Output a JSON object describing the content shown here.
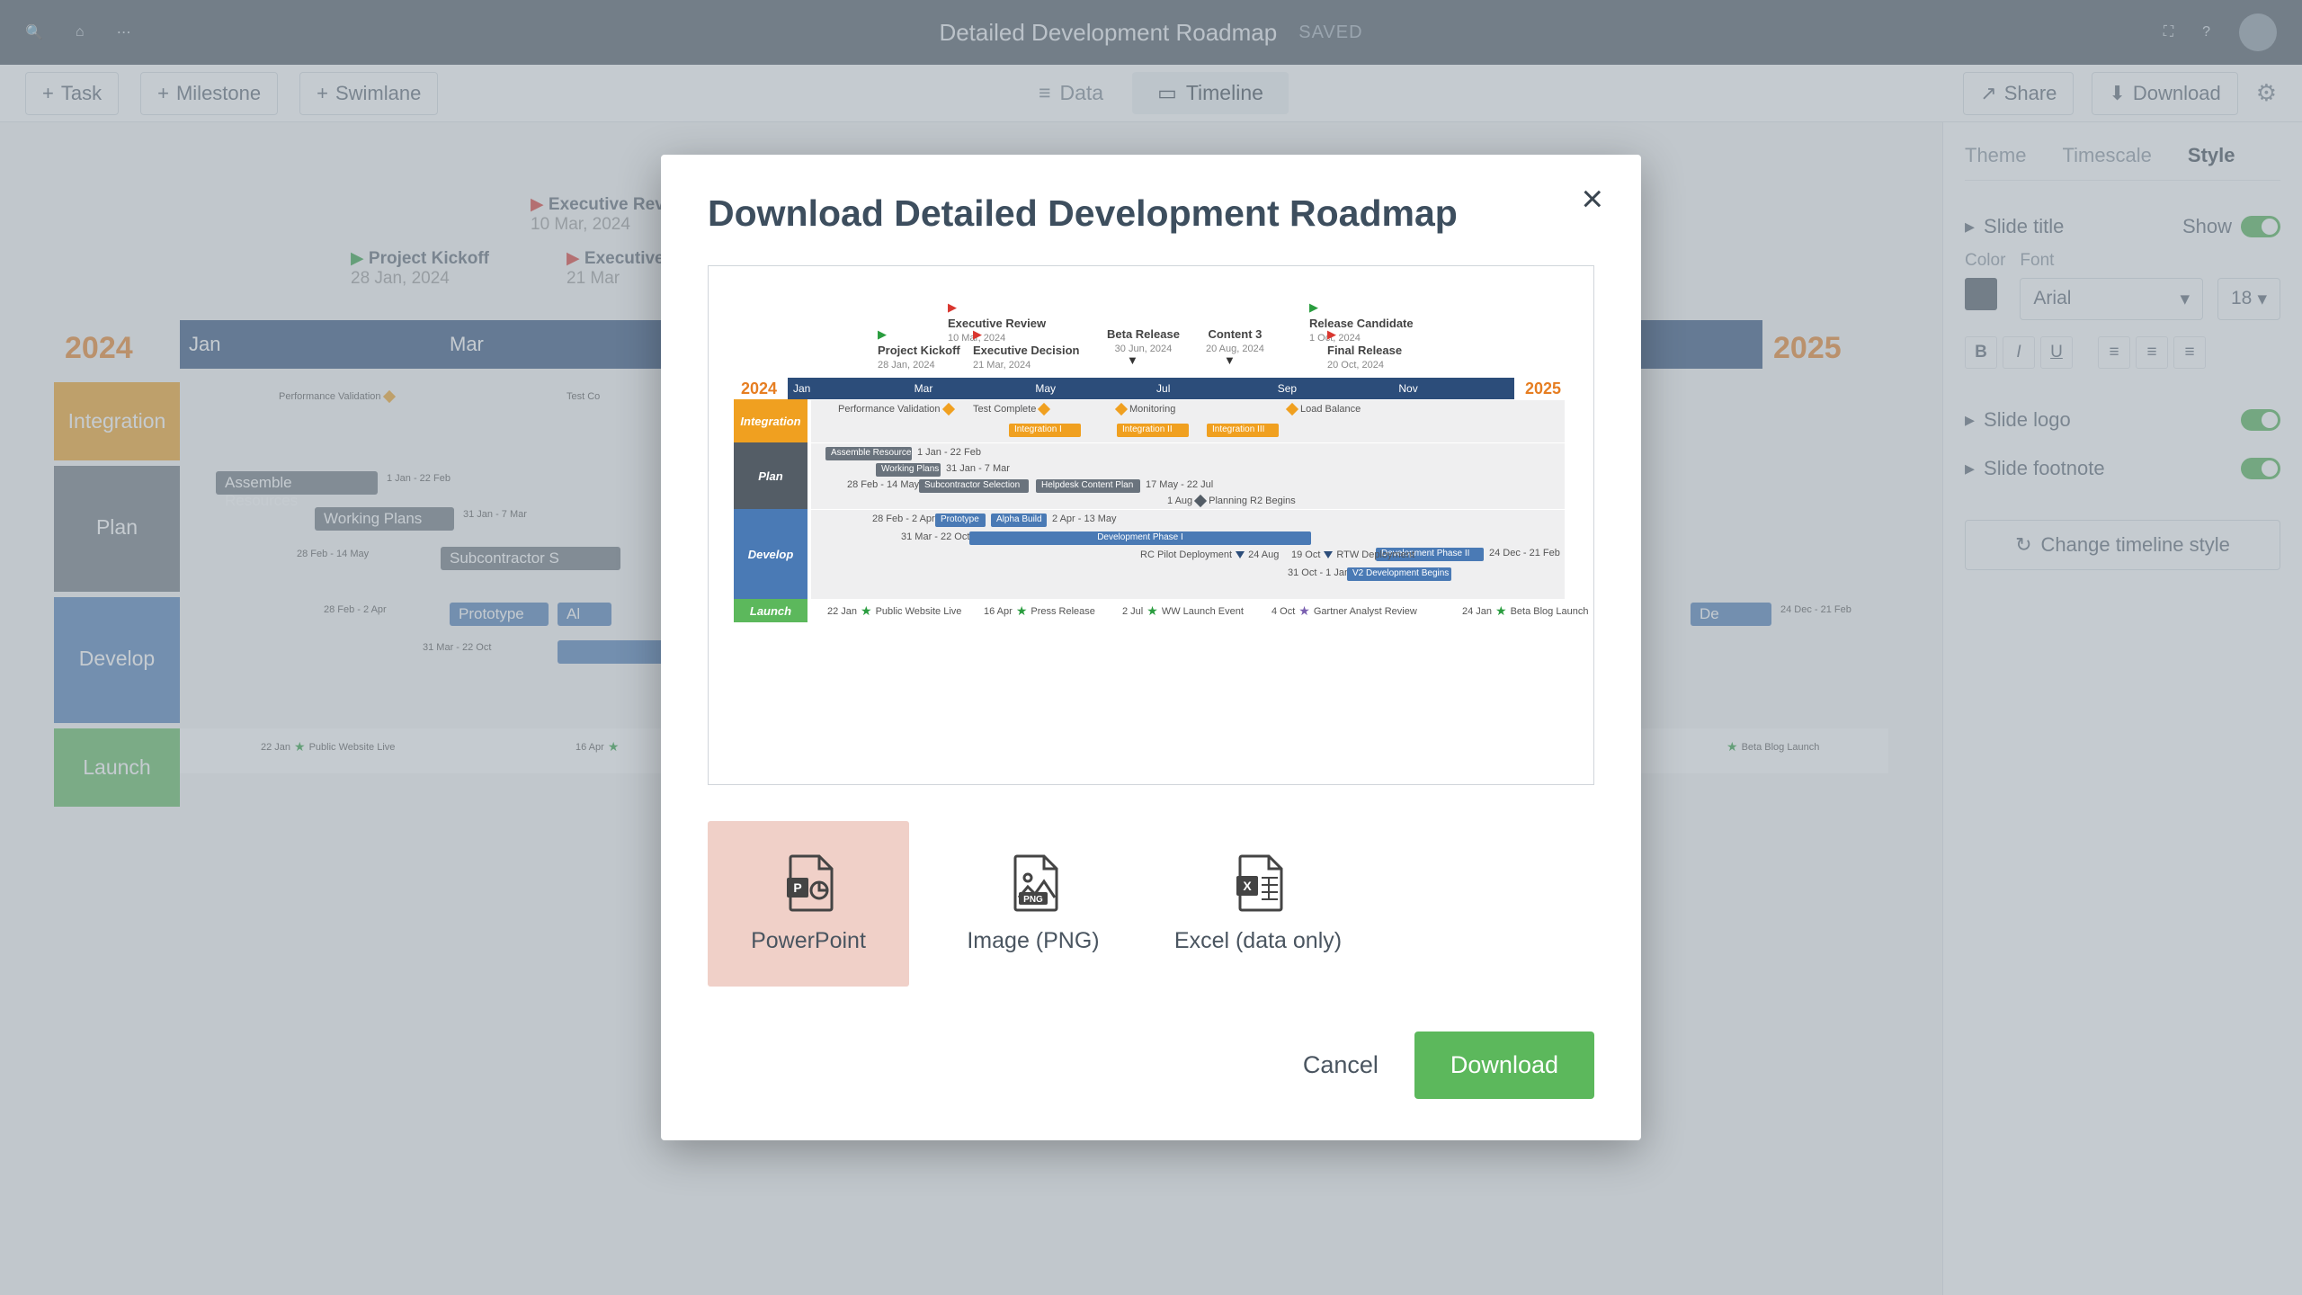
{
  "topbar": {
    "title": "Detailed Development Roadmap",
    "status": "Saved"
  },
  "toolbar": {
    "task": "Task",
    "milestone": "Milestone",
    "swimlane": "Swimlane",
    "data_tab": "Data",
    "timeline_tab": "Timeline",
    "share": "Share",
    "download": "Download"
  },
  "sidepanel": {
    "tabs": {
      "theme": "Theme",
      "timescale": "Timescale",
      "style": "Style"
    },
    "slide_title": "Slide title",
    "show_label": "Show",
    "color_label": "Color",
    "font_label": "Font",
    "font_value": "Arial",
    "font_size": "18",
    "slide_logo": "Slide logo",
    "slide_footnote": "Slide footnote",
    "change_style": "Change timeline style"
  },
  "bg_timeline": {
    "year_start": "2024",
    "year_end": "2025",
    "months": [
      "Jan",
      "Mar"
    ],
    "lanes": {
      "integration": "Integration",
      "plan": "Plan",
      "develop": "Develop",
      "launch": "Launch"
    },
    "ms": {
      "kickoff_t": "Project Kickoff",
      "kickoff_d": "28 Jan, 2024",
      "exec_rev_t": "Executive Review",
      "exec_rev_d": "10 Mar, 2024",
      "exec_dec_t": "Executive",
      "exec_dec_d": "21 Mar"
    },
    "items": {
      "perf": "Performance Validation",
      "testc": "Test Co",
      "assemble": "Assemble Resources",
      "assemble_d": "1 Jan - 22 Feb",
      "working": "Working Plans",
      "working_d": "31 Jan - 7 Mar",
      "sub_d": "28 Feb - 14 May",
      "sub": "Subcontractor S",
      "proto_d": "28 Feb - 2 Apr",
      "proto": "Prototype",
      "alp": "Al",
      "devp_d": "31 Mar - 22 Oct",
      "pw_d": "22 Jan",
      "pw": "Public Website Live",
      "pr_d": "16 Apr",
      "devph2": "De",
      "devph2_d": "24 Dec - 21 Feb",
      "beta": "Beta Blog Launch"
    }
  },
  "modal": {
    "title": "Download Detailed Development Roadmap",
    "formats": {
      "ppt": "PowerPoint",
      "png": "Image (PNG)",
      "excel": "Excel (data only)",
      "png_badge": "PNG"
    },
    "cancel": "Cancel",
    "download": "Download"
  },
  "preview": {
    "year_start": "2024",
    "year_end": "2025",
    "months": [
      "Jan",
      "Mar",
      "May",
      "Jul",
      "Sep",
      "Nov"
    ],
    "lanes": {
      "integration": "Integration",
      "plan": "Plan",
      "develop": "Develop",
      "launch": "Launch"
    },
    "milestones": {
      "kickoff": {
        "title": "Project Kickoff",
        "date": "28 Jan, 2024"
      },
      "exec_rev": {
        "title": "Executive Review",
        "date": "10 Mar, 2024"
      },
      "exec_dec": {
        "title": "Executive Decision",
        "date": "21 Mar, 2024"
      },
      "beta": {
        "title": "Beta Release",
        "date": "30 Jun, 2024"
      },
      "content3": {
        "title": "Content 3",
        "date": "20 Aug, 2024"
      },
      "rc": {
        "title": "Release Candidate",
        "date": "1 Oct, 2024"
      },
      "final": {
        "title": "Final Release",
        "date": "20 Oct, 2024"
      }
    },
    "integration": {
      "perf": "Performance Validation",
      "test": "Test Complete",
      "mon": "Monitoring",
      "load": "Load Balance",
      "i1": "Integration I",
      "i2": "Integration II",
      "i3": "Integration III"
    },
    "plan": {
      "assemble": "Assemble Resources",
      "assemble_d": "1 Jan - 22 Feb",
      "working": "Working Plans",
      "working_d": "31 Jan - 7 Mar",
      "sub_d": "28 Feb - 14 May",
      "sub": "Subcontractor Selection",
      "help": "Helpdesk Content Plan",
      "help_d": "17 May - 22 Jul",
      "r2_d": "1 Aug",
      "r2": "Planning R2 Begins"
    },
    "develop": {
      "proto_d": "28 Feb - 2 Apr",
      "proto": "Prototype",
      "alpha": "Alpha Build",
      "alpha_d": "2 Apr - 13 May",
      "devp_d": "31 Mar - 22 Oct",
      "devp": "Development Phase I",
      "rcpilot": "RC Pilot Deployment",
      "rcpilot_d": "24 Aug",
      "rtw_d": "19 Oct",
      "rtw": "RTW Deployment",
      "devp2": "Development Phase II",
      "devp2_d": "24 Dec - 21 Feb",
      "v2_d": "31 Oct - 1 Jan",
      "v2": "V2 Development Begins"
    },
    "launch": {
      "pw_d": "22 Jan",
      "pw": "Public Website Live",
      "pr_d": "16 Apr",
      "pr": "Press Release",
      "ww_d": "2 Jul",
      "ww": "WW Launch Event",
      "ga_d": "4 Oct",
      "ga": "Gartner Analyst Review",
      "bb_d": "24 Jan",
      "bb": "Beta Blog Launch"
    }
  }
}
